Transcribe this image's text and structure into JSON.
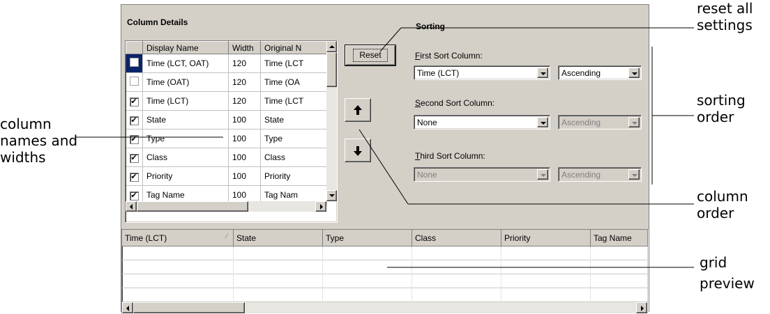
{
  "column_details": {
    "title": "Column Details",
    "headers": [
      "",
      "Display Name",
      "Width",
      "Original N"
    ],
    "rows": [
      {
        "checked": false,
        "selected": true,
        "name": "Time (LCT, OAT)",
        "width": "120",
        "original": "Time (LCT"
      },
      {
        "checked": false,
        "selected": false,
        "name": "Time (OAT)",
        "width": "120",
        "original": "Time (OA"
      },
      {
        "checked": true,
        "selected": false,
        "name": "Time (LCT)",
        "width": "120",
        "original": "Time (LCT"
      },
      {
        "checked": true,
        "selected": false,
        "name": "State",
        "width": "100",
        "original": "State"
      },
      {
        "checked": true,
        "selected": false,
        "name": "Type",
        "width": "100",
        "original": "Type"
      },
      {
        "checked": true,
        "selected": false,
        "name": "Class",
        "width": "100",
        "original": "Class"
      },
      {
        "checked": true,
        "selected": false,
        "name": "Priority",
        "width": "100",
        "original": "Priority"
      },
      {
        "checked": true,
        "selected": false,
        "name": "Tag Name",
        "width": "100",
        "original": "Tag Nam"
      }
    ]
  },
  "buttons": {
    "reset_label": "Reset",
    "move_up_icon": "arrow-up",
    "move_down_icon": "arrow-down"
  },
  "sorting": {
    "title": "Sorting",
    "first_label": "First Sort Column:",
    "first_column": "Time (LCT)",
    "first_order": "Ascending",
    "second_label": "Second Sort Column:",
    "second_column": "None",
    "second_order": "Ascending",
    "third_label": "Third Sort Column:",
    "third_column": "None",
    "third_order": "Ascending"
  },
  "grid_preview": {
    "columns": [
      "Time (LCT)",
      "State",
      "Type",
      "Class",
      "Priority",
      "Tag Name"
    ]
  },
  "callouts": {
    "reset_line1": "reset all",
    "reset_line2": "settings",
    "sorting_line1": "sorting",
    "sorting_line2": "order",
    "names_line1": "column",
    "names_line2": "names and",
    "names_line3": "widths",
    "order_line1": "column",
    "order_line2": "order",
    "grid_line1": "grid",
    "grid_line2": "preview"
  },
  "colors": {
    "dialog_face": "#d4d0c8",
    "selection": "#0a246a"
  }
}
